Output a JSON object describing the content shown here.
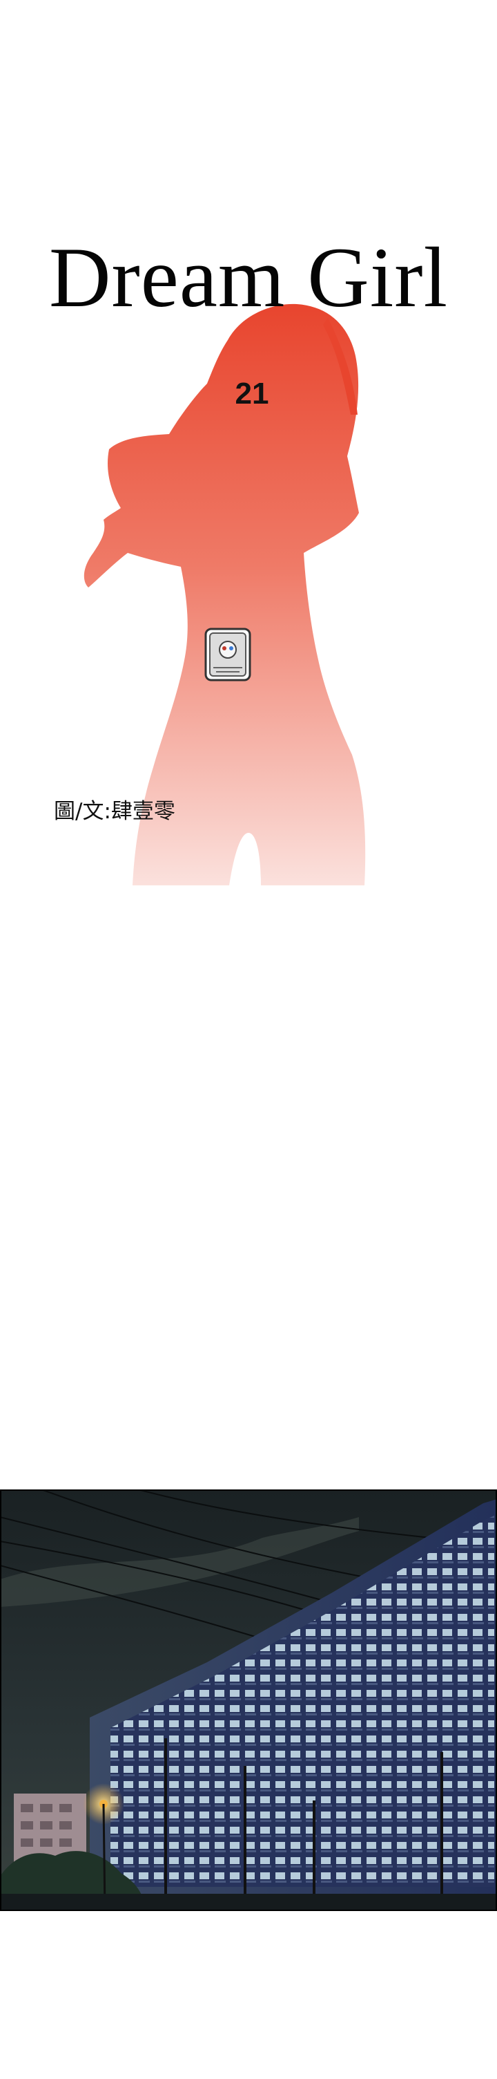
{
  "cover": {
    "title": "Dream Girl",
    "episode": "21",
    "credit": "圖/文:肆壹零",
    "accent_top": "#e8452e",
    "accent_bottom": "#fbe1dd"
  },
  "panel": {
    "sky_color": "#1d2426",
    "window_glow": "#d7f0f8",
    "street_lamp_color": "#f3b23f"
  }
}
